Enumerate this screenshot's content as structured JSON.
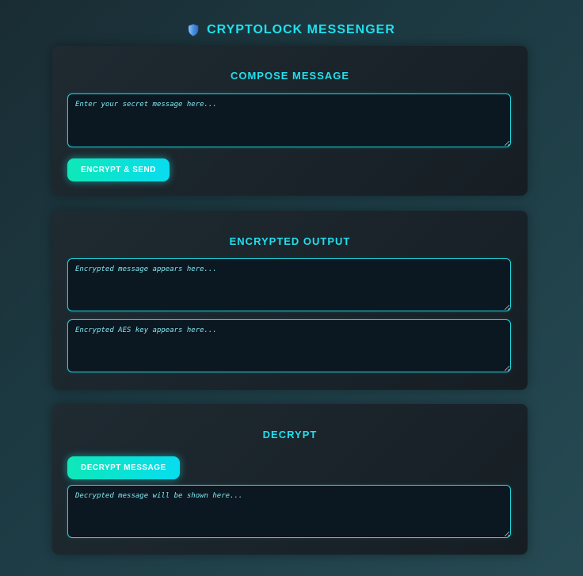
{
  "header": {
    "title": "CRYPTOLOCK MESSENGER",
    "icon": "shield-icon"
  },
  "compose": {
    "heading": "COMPOSE MESSAGE",
    "placeholder": "Enter your secret message here...",
    "button_label": "ENCRYPT & SEND"
  },
  "output": {
    "heading": "ENCRYPTED OUTPUT",
    "message_placeholder": "Encrypted message appears here...",
    "key_placeholder": "Encrypted AES key appears here..."
  },
  "decrypt": {
    "heading": "DECRYPT",
    "button_label": "DECRYPT MESSAGE",
    "placeholder": "Decrypted message will be shown here..."
  },
  "colors": {
    "accent": "#1fe0ee",
    "button_gradient_start": "#0ee8b8",
    "button_gradient_end": "#08dcf0",
    "card_bg": "#1b242b",
    "input_bg": "#0b1721"
  }
}
